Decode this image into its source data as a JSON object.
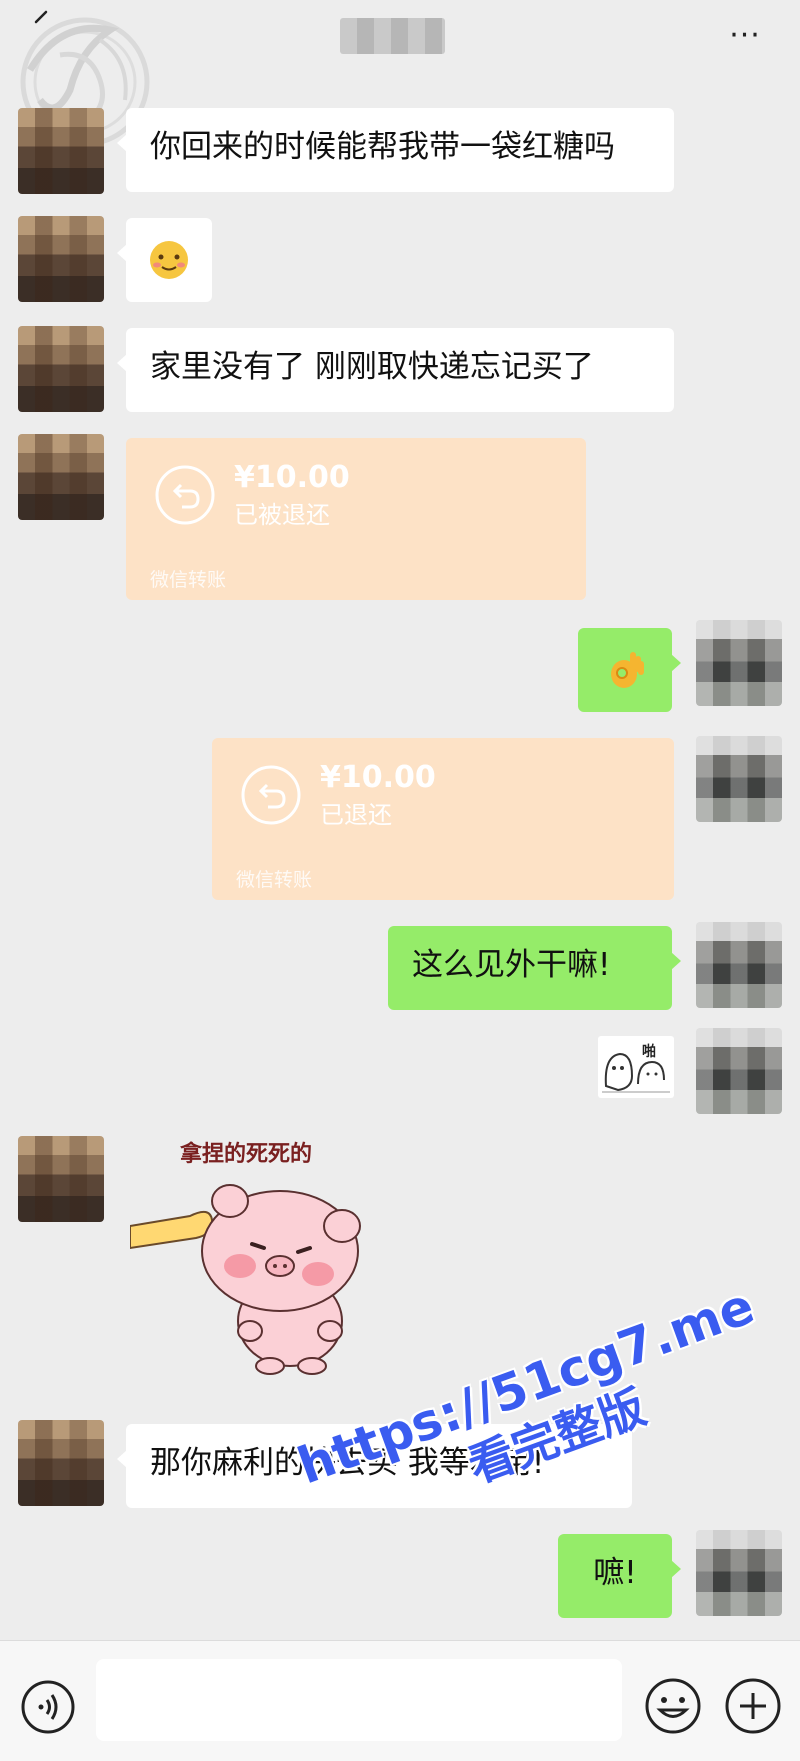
{
  "header": {
    "title": "",
    "more_label": "···"
  },
  "messages": [
    {
      "side": "left",
      "type": "text",
      "text": "你回来的时候能帮我带一袋红糖吗"
    },
    {
      "side": "left",
      "type": "emoji",
      "text": "🥴",
      "emoji_name": "smiling-face-icon"
    },
    {
      "side": "left",
      "type": "text",
      "text": "家里没有了 刚刚取快递忘记买了"
    },
    {
      "side": "left",
      "type": "transfer",
      "amount": "¥10.00",
      "status": "已被退还",
      "footer": "微信转账"
    },
    {
      "side": "right",
      "type": "emoji",
      "text": "👌",
      "emoji_name": "ok-hand-icon"
    },
    {
      "side": "right",
      "type": "transfer",
      "amount": "¥10.00",
      "status": "已退还",
      "footer": "微信转账"
    },
    {
      "side": "right",
      "type": "text",
      "text": "这么见外干嘛!"
    },
    {
      "side": "right",
      "type": "sticker",
      "sticker_text": "啪"
    },
    {
      "side": "left",
      "type": "sticker",
      "sticker_text": "拿捏的死死的"
    },
    {
      "side": "left",
      "type": "text",
      "text": "那你麻利的快去买  我等着用!"
    },
    {
      "side": "right",
      "type": "text",
      "text": "嗻!"
    }
  ],
  "watermark": {
    "line1": "https://51cg7.me",
    "line2": "看完整版",
    "color": "#3a5cf0"
  },
  "input_bar": {
    "value": "",
    "voice_icon": "voice-icon",
    "emoji_icon": "emoji-icon",
    "plus_icon": "plus-icon"
  },
  "colors": {
    "background": "#ededed",
    "green_bubble": "#95ec69",
    "white_bubble": "#ffffff",
    "transfer_card": "#fde2c6"
  }
}
